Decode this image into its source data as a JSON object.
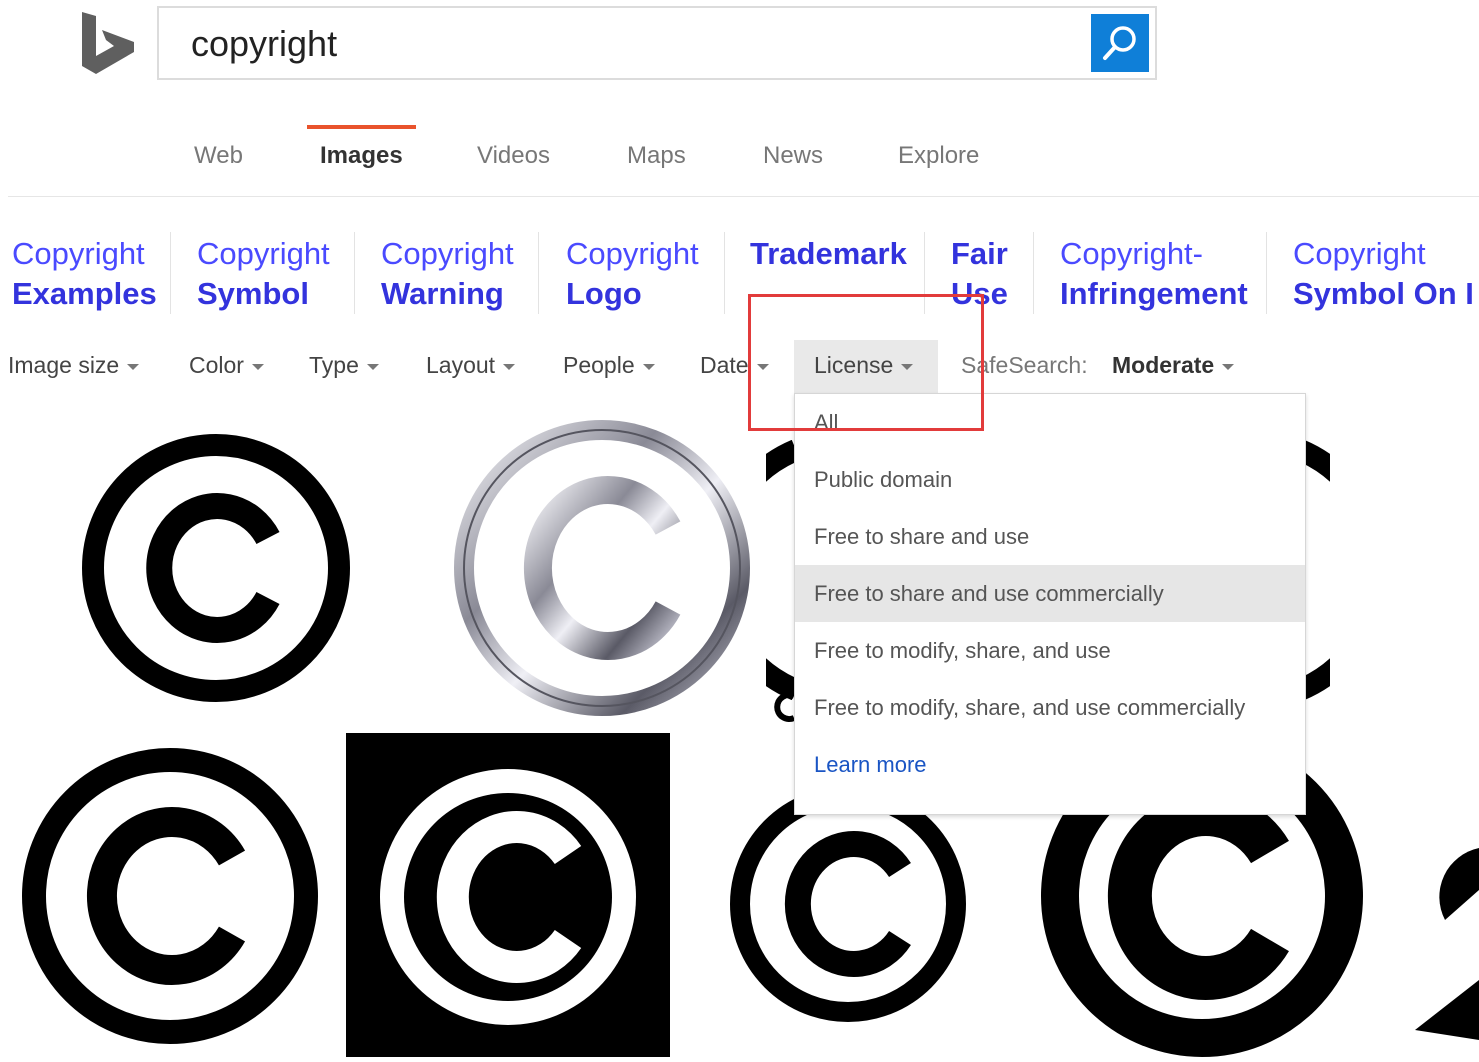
{
  "search": {
    "query": "copyright"
  },
  "scopes": [
    {
      "label": "Web",
      "active": false
    },
    {
      "label": "Images",
      "active": true
    },
    {
      "label": "Videos",
      "active": false
    },
    {
      "label": "Maps",
      "active": false
    },
    {
      "label": "News",
      "active": false
    },
    {
      "label": "Explore",
      "active": false
    }
  ],
  "related": [
    {
      "line1": "Copyright",
      "line2": "Examples"
    },
    {
      "line1": "Copyright",
      "line2": "Symbol"
    },
    {
      "line1": "Copyright",
      "line2": "Warning"
    },
    {
      "line1": "Copyright",
      "line2": "Logo"
    },
    {
      "line1": "Trademark",
      "line2": ""
    },
    {
      "line1": "Fair",
      "line2": "Use"
    },
    {
      "line1": "Copyright-",
      "line2": "Infringement"
    },
    {
      "line1": "Copyright",
      "line2": "Symbol On I"
    }
  ],
  "filters": {
    "image_size": "Image size",
    "color": "Color",
    "type": "Type",
    "layout": "Layout",
    "people": "People",
    "date": "Date",
    "license": "License",
    "safesearch_label": "SafeSearch:",
    "safesearch_value": "Moderate"
  },
  "license_menu": {
    "options": [
      "All",
      "Public domain",
      "Free to share and use",
      "Free to share and use commercially",
      "Free to modify, share, and use",
      "Free to modify, share, and use commercially"
    ],
    "hovered_index": 3,
    "learn_more": "Learn more"
  },
  "colors": {
    "accent_blue": "#0f7fd8",
    "active_underline": "#e9532c",
    "related_link": "#4a4aff",
    "highlight_box": "#e23b3b"
  },
  "icons": {
    "logo": "bing-logo",
    "search": "magnifier-icon",
    "dropdown": "caret-down-icon",
    "thumbnail": "copyright-symbol"
  }
}
